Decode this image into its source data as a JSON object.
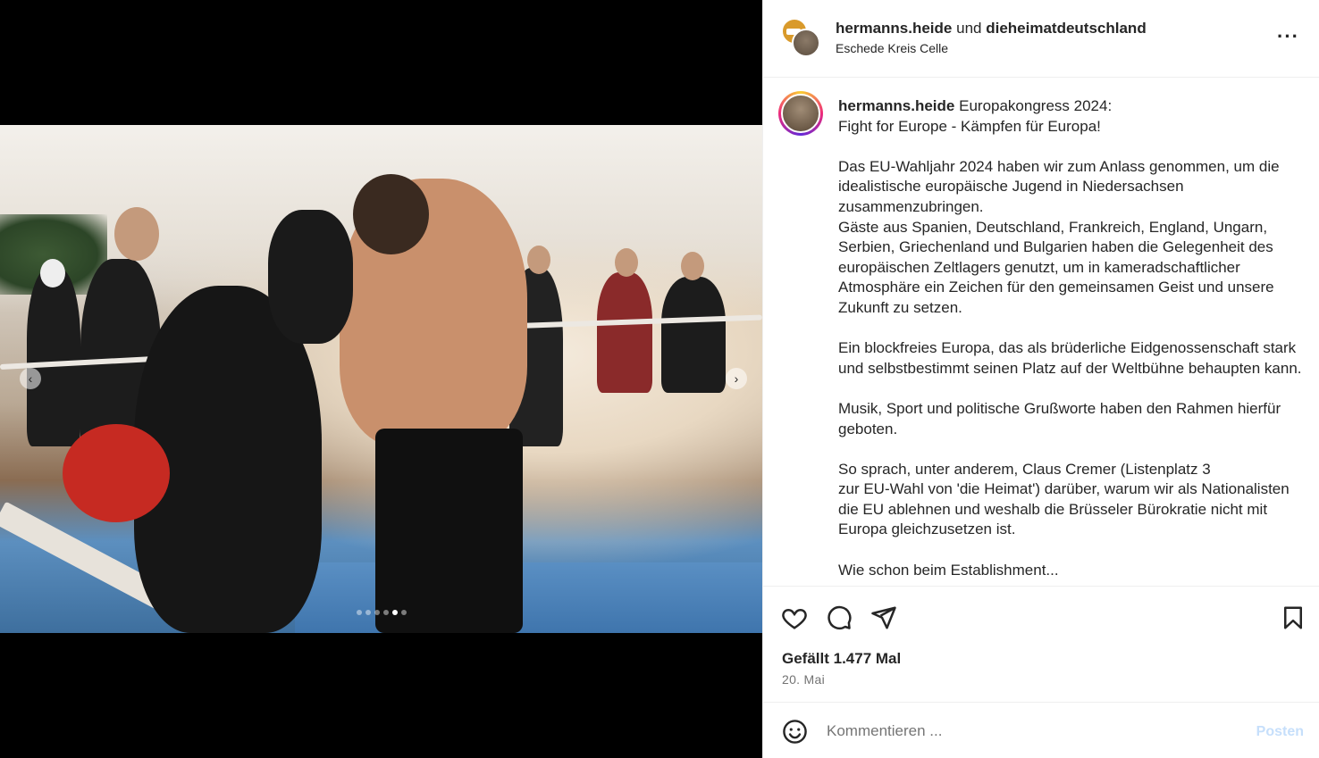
{
  "carousel": {
    "slide_count": 6,
    "active_index": 4
  },
  "header": {
    "user1": "hermanns.heide",
    "joiner": "und",
    "user2": "dieheimatdeutschland",
    "location": "Eschede Kreis Celle",
    "more_icon": "more-options-icon"
  },
  "caption": {
    "username": "hermanns.heide",
    "text": "Europakongress 2024:\nFight for Europe - Kämpfen für Europa!\n\nDas EU-Wahljahr 2024 haben wir zum Anlass genommen, um die idealistische europäische Jugend in Niedersachsen zusammenzubringen.\nGäste aus Spanien, Deutschland, Frankreich, England, Ungarn, Serbien, Griechenland und Bulgarien haben die Gelegenheit des europäischen Zeltlagers genutzt, um in kameradschaftlicher Atmosphäre ein Zeichen für den gemeinsamen Geist und unsere Zukunft zu setzen.\n\nEin blockfreies Europa, das als brüderliche Eidgenossenschaft stark und selbstbestimmt seinen Platz auf der Weltbühne behaupten kann.\n\nMusik, Sport und politische Grußworte haben den Rahmen hierfür geboten.\n\nSo sprach, unter anderem, Claus Cremer (Listenplatz 3\nzur EU-Wahl von 'die Heimat') darüber, warum wir als Nationalisten die EU ablehnen und weshalb die Brüsseler Bürokratie nicht mit Europa gleichzusetzen ist.\n\nWie schon beim Establishment..."
  },
  "actions": {
    "likes": "Gefällt 1.477 Mal",
    "date": "20. Mai",
    "icons": [
      "heart-icon",
      "comment-icon",
      "share-icon",
      "bookmark-icon"
    ]
  },
  "comment": {
    "placeholder": "Kommentieren ...",
    "post_label": "Posten"
  },
  "colors": {
    "accent_disabled": "#c6dffb",
    "muted": "#737373"
  }
}
